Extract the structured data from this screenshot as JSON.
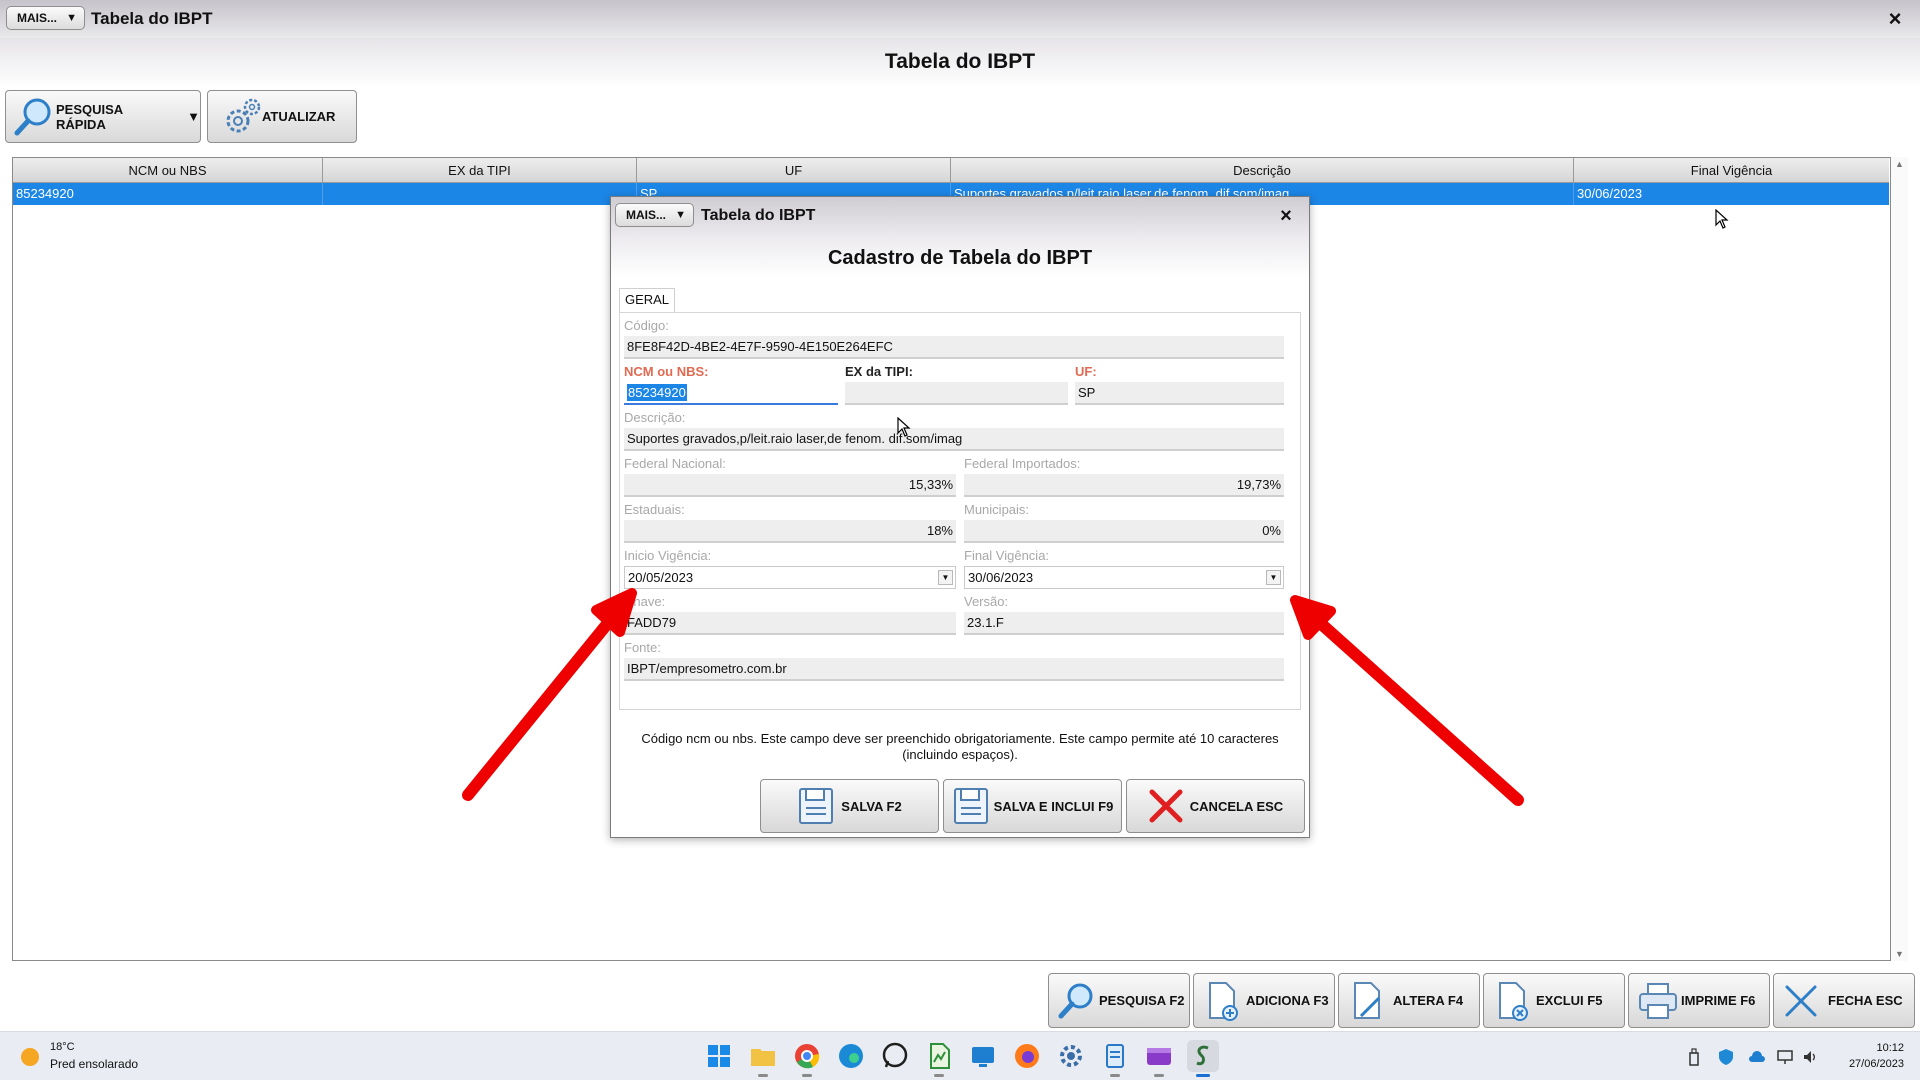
{
  "window": {
    "mais_label": "MAIS...",
    "title": "Tabela do IBPT",
    "close_glyph": "×",
    "heading": "Tabela do IBPT"
  },
  "toolbar": {
    "quick_search_label": "PESQUISA RÁPIDA",
    "update_label": "ATUALIZAR"
  },
  "grid": {
    "columns": [
      "NCM ou NBS",
      "EX da TIPI",
      "UF",
      "Descrição",
      "Final Vigência"
    ],
    "selected_row": {
      "ncm": "85234920",
      "ex": "",
      "uf": "SP",
      "descricao": "Suportes gravados,p/leit.raio laser,de fenom. dif.som/imag",
      "final": "30/06/2023"
    }
  },
  "dialog": {
    "mais_label": "MAIS...",
    "title": "Tabela do IBPT",
    "close_glyph": "×",
    "heading": "Cadastro de Tabela do IBPT",
    "tab_label": "GERAL",
    "fields": {
      "codigo": {
        "label": "Código:",
        "value": "8FE8F42D-4BE2-4E7F-9590-4E150E264EFC"
      },
      "ncm": {
        "label": "NCM ou NBS:",
        "value": "85234920"
      },
      "ex_tipi": {
        "label": "EX da TIPI:",
        "value": ""
      },
      "uf": {
        "label": "UF:",
        "value": "SP"
      },
      "descricao": {
        "label": "Descrição:",
        "value": "Suportes gravados,p/leit.raio laser,de fenom. dif.som/imag"
      },
      "federal_nacional": {
        "label": "Federal Nacional:",
        "value": "15,33%"
      },
      "federal_importados": {
        "label": "Federal Importados:",
        "value": "19,73%"
      },
      "estaduais": {
        "label": "Estaduais:",
        "value": "18%"
      },
      "municipais": {
        "label": "Municipais:",
        "value": "0%"
      },
      "inicio_vigencia": {
        "label": "Inicio Vigência:",
        "value": "20/05/2023"
      },
      "final_vigencia": {
        "label": "Final Vigência:",
        "value": "30/06/2023"
      },
      "chave": {
        "label": "Chave:",
        "value": "FADD79"
      },
      "versao": {
        "label": "Versão:",
        "value": "23.1.F"
      },
      "fonte": {
        "label": "Fonte:",
        "value": "IBPT/empresometro.com.br"
      }
    },
    "hint_line1": "Código ncm ou nbs. Este campo deve ser preenchido obrigatoriamente. Este campo permite até 10 caracteres",
    "hint_line2": "(incluindo espaços).",
    "buttons": {
      "save": "SALVA F2",
      "save_include": "SALVA E INCLUI F9",
      "cancel": "CANCELA ESC"
    }
  },
  "bottom_buttons": {
    "search": "PESQUISA F2",
    "add": "ADICIONA F3",
    "edit": "ALTERA F4",
    "delete": "EXCLUI F5",
    "print": "IMPRIME F6",
    "close": "FECHA ESC"
  },
  "taskbar": {
    "weather_temp": "18°C",
    "weather_desc": "Pred ensolarado",
    "time": "10:12",
    "date": "27/06/2023"
  },
  "colors": {
    "selection_blue": "#1c86e6",
    "required_label": "#e06a52",
    "annotation_arrow": "#ee0000"
  }
}
